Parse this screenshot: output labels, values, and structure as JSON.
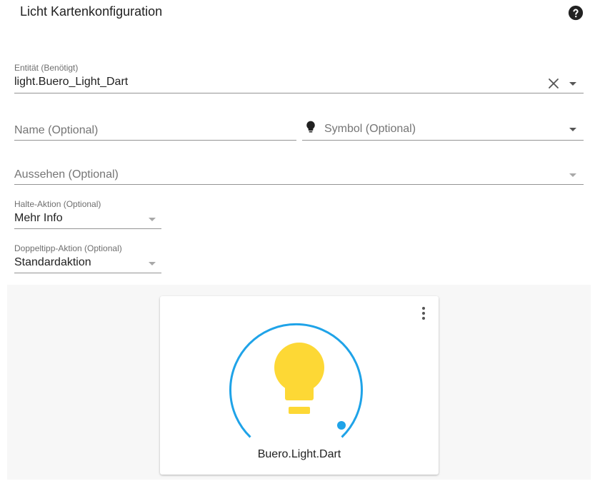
{
  "header": {
    "title": "Licht Kartenkonfiguration",
    "help_icon": "help-circle-icon"
  },
  "form": {
    "entity": {
      "label": "Entität (Benötigt)",
      "value": "light.Buero_Light_Dart"
    },
    "name": {
      "placeholder": "Name (Optional)"
    },
    "symbol": {
      "placeholder": "Symbol (Optional)",
      "icon": "lightbulb-icon"
    },
    "theme": {
      "placeholder": "Aussehen (Optional)"
    },
    "hold_action": {
      "label": "Halte-Aktion (Optional)",
      "value": "Mehr Info"
    },
    "double_tap_action": {
      "label": "Doppeltipp-Aktion (Optional)",
      "value": "Standardaktion"
    }
  },
  "preview": {
    "card_name": "Buero.Light.Dart",
    "colors": {
      "arc": "#1fa3e8",
      "bulb": "#fdd835",
      "background": "#f7f7f7"
    }
  }
}
